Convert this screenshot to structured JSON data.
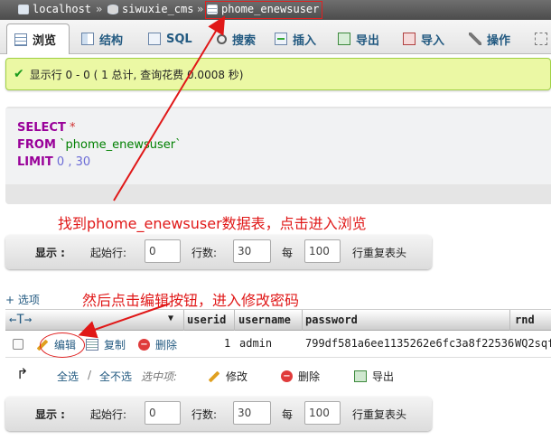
{
  "breadcrumb": {
    "server": "localhost",
    "database": "siwuxie_cms",
    "table": "phome_enewsuser",
    "separator": "»"
  },
  "tabs": [
    {
      "label": "浏览",
      "icon": "browse-icon",
      "active": true
    },
    {
      "label": "结构",
      "icon": "structure-icon",
      "active": false
    },
    {
      "label": "SQL",
      "icon": "sql-icon",
      "active": false
    },
    {
      "label": "搜索",
      "icon": "search-icon",
      "active": false
    },
    {
      "label": "插入",
      "icon": "insert-icon",
      "active": false
    },
    {
      "label": "导出",
      "icon": "export-icon",
      "active": false
    },
    {
      "label": "导入",
      "icon": "import-icon",
      "active": false
    },
    {
      "label": "操作",
      "icon": "wrench-icon",
      "active": false
    }
  ],
  "message": "显示行 0 - 0 ( 1 总计, 查询花费 0.0008 秒)",
  "sql": {
    "select": "SELECT",
    "star": "*",
    "from": "FROM",
    "table": "`phome_enewsuser`",
    "limit": "LIMIT",
    "limit_start": "0",
    "limit_sep": ",",
    "limit_count": "30"
  },
  "annotations": {
    "note1": "找到phome_enewsuser数据表，点击进入浏览",
    "note2": "然后点击编辑按钮，进入修改密码"
  },
  "nav": {
    "show_label": "显示 :",
    "start_label": "起始行:",
    "start_value": "0",
    "rows_label": "行数:",
    "rows_value": "30",
    "each_label": "每",
    "each_value": "100",
    "repeat_label": "行重复表头"
  },
  "options_link": "+ 选项",
  "table": {
    "sort_arrows": "←T→",
    "columns": [
      "userid",
      "username",
      "password",
      "rnd"
    ],
    "row": {
      "edit": "编辑",
      "copy": "复制",
      "delete": "删除",
      "userid": "1",
      "username": "admin",
      "password": "799df581a6ee1135262e6fc3a8f22536",
      "rnd": "WQ2sqf"
    }
  },
  "bulk": {
    "select_all": "全选",
    "slash": "/",
    "deselect_all": "全不选",
    "selected_label": "选中项:",
    "modify": "修改",
    "delete": "删除",
    "export": "导出"
  },
  "colors": {
    "annotation_red": "#e01818",
    "link_blue": "#235a81",
    "success_green": "#ebf8a4",
    "sql_keyword": "#990099"
  }
}
